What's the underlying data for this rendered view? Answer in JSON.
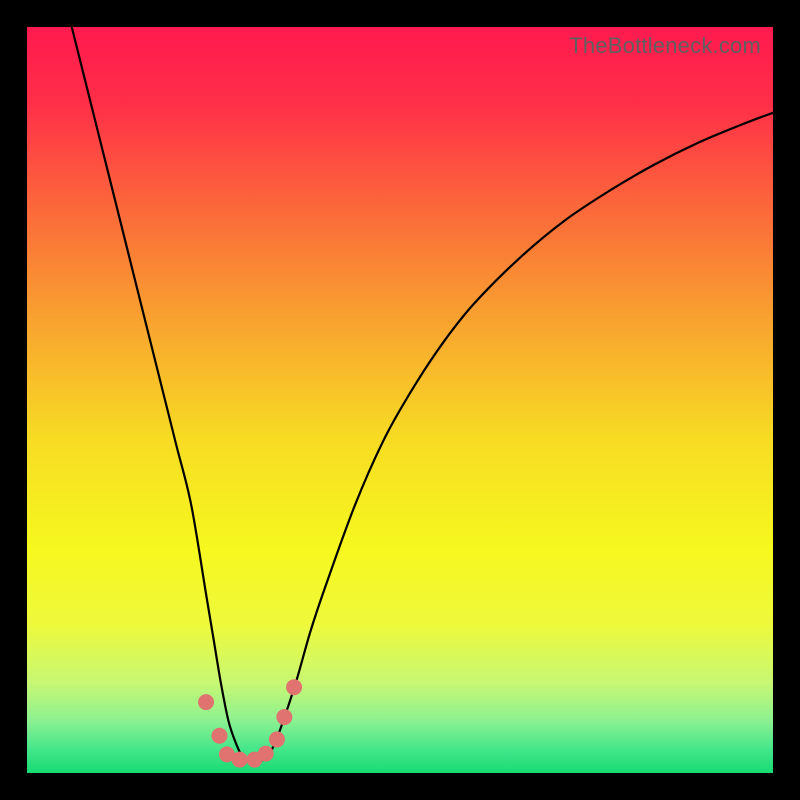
{
  "watermark": "TheBottleneck.com",
  "chart_data": {
    "type": "line",
    "title": "",
    "xlabel": "",
    "ylabel": "",
    "xlim": [
      0,
      100
    ],
    "ylim": [
      0,
      100
    ],
    "grid": false,
    "series": [
      {
        "name": "bottleneck-curve",
        "x": [
          6,
          8,
          10,
          12,
          14,
          16,
          18,
          20,
          22,
          24,
          25,
          26,
          27,
          28,
          29,
          30,
          31,
          32,
          33,
          34,
          36,
          38,
          40,
          44,
          48,
          52,
          56,
          60,
          66,
          72,
          78,
          84,
          90,
          96,
          100
        ],
        "values": [
          100,
          92,
          84,
          76,
          68,
          60,
          52,
          44,
          36,
          24,
          18,
          12,
          7,
          4,
          2,
          1.5,
          1.5,
          2,
          3.5,
          6,
          12,
          19,
          25,
          36,
          45,
          52,
          58,
          63,
          69,
          74,
          78,
          81.5,
          84.5,
          87,
          88.5
        ]
      }
    ],
    "markers": {
      "name": "highlight-dots",
      "color": "#e0736f",
      "radius_px": 8,
      "points": [
        {
          "x": 24.0,
          "y": 9.5
        },
        {
          "x": 25.8,
          "y": 5.0
        },
        {
          "x": 26.8,
          "y": 2.5
        },
        {
          "x": 28.5,
          "y": 1.8
        },
        {
          "x": 30.5,
          "y": 1.8
        },
        {
          "x": 32.0,
          "y": 2.6
        },
        {
          "x": 33.5,
          "y": 4.5
        },
        {
          "x": 34.5,
          "y": 7.5
        },
        {
          "x": 35.8,
          "y": 11.5
        }
      ]
    },
    "gradient_stops": [
      {
        "pos": 0.0,
        "color": "#ff1a4f"
      },
      {
        "pos": 0.1,
        "color": "#ff2e48"
      },
      {
        "pos": 0.25,
        "color": "#fb6b3a"
      },
      {
        "pos": 0.4,
        "color": "#f8a52f"
      },
      {
        "pos": 0.55,
        "color": "#f7db23"
      },
      {
        "pos": 0.7,
        "color": "#f6f81f"
      },
      {
        "pos": 0.8,
        "color": "#eef93b"
      },
      {
        "pos": 0.88,
        "color": "#c7f774"
      },
      {
        "pos": 0.93,
        "color": "#8cf191"
      },
      {
        "pos": 0.97,
        "color": "#41e58a"
      },
      {
        "pos": 1.0,
        "color": "#18db71"
      }
    ]
  }
}
